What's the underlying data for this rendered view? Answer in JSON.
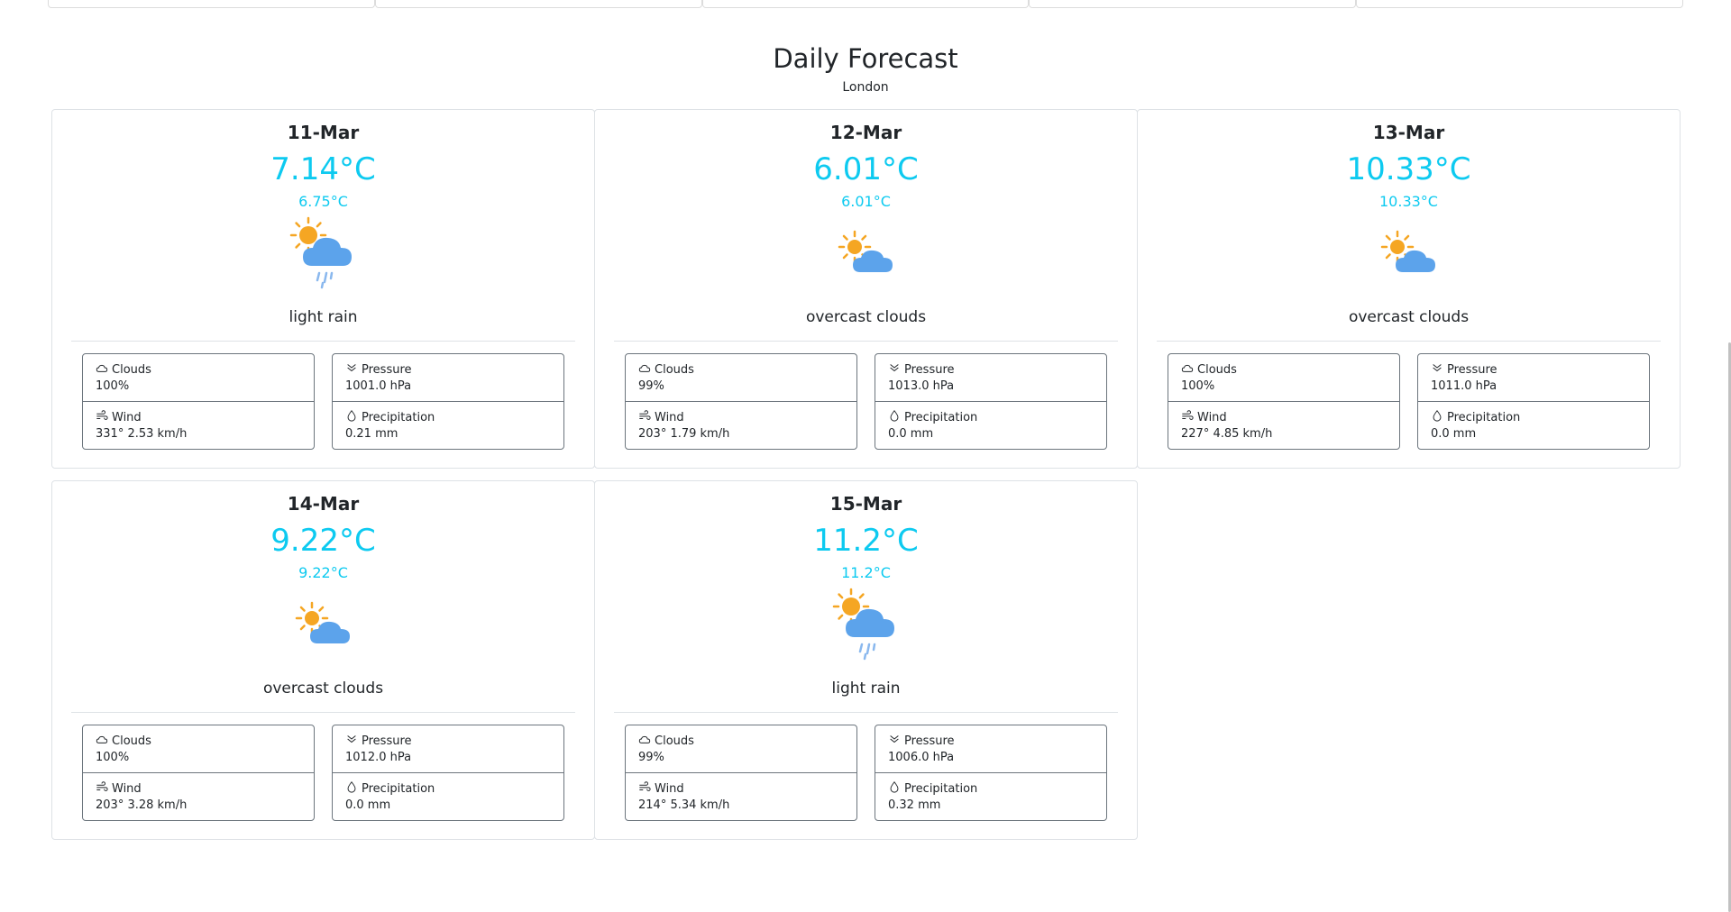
{
  "section": {
    "title": "Daily Forecast",
    "city": "London"
  },
  "labels": {
    "clouds": "Clouds",
    "pressure": "Pressure",
    "wind": "Wind",
    "precipitation": "Precipitation"
  },
  "colors": {
    "accent": "#0dcaf0",
    "sun": "#f5a623",
    "cloud": "#5ca3eb",
    "rain": "#8ab8ee",
    "border": "#dee2e6"
  },
  "days": [
    {
      "date": "11-Mar",
      "temp": "7.14°C",
      "feels": "6.75°C",
      "icon": "light-rain-icon",
      "desc": "light rain",
      "clouds": "100%",
      "pressure": "1001.0 hPa",
      "wind": "331° 2.53 km/h",
      "precipitation": "0.21 mm"
    },
    {
      "date": "12-Mar",
      "temp": "6.01°C",
      "feels": "6.01°C",
      "icon": "overcast-clouds-icon",
      "desc": "overcast clouds",
      "clouds": "99%",
      "pressure": "1013.0 hPa",
      "wind": "203° 1.79 km/h",
      "precipitation": "0.0 mm"
    },
    {
      "date": "13-Mar",
      "temp": "10.33°C",
      "feels": "10.33°C",
      "icon": "overcast-clouds-icon",
      "desc": "overcast clouds",
      "clouds": "100%",
      "pressure": "1011.0 hPa",
      "wind": "227° 4.85 km/h",
      "precipitation": "0.0 mm"
    },
    {
      "date": "14-Mar",
      "temp": "9.22°C",
      "feels": "9.22°C",
      "icon": "overcast-clouds-icon",
      "desc": "overcast clouds",
      "clouds": "100%",
      "pressure": "1012.0 hPa",
      "wind": "203° 3.28 km/h",
      "precipitation": "0.0 mm"
    },
    {
      "date": "15-Mar",
      "temp": "11.2°C",
      "feels": "11.2°C",
      "icon": "light-rain-icon",
      "desc": "light rain",
      "clouds": "99%",
      "pressure": "1006.0 hPa",
      "wind": "214° 5.34 km/h",
      "precipitation": "0.32 mm"
    }
  ]
}
